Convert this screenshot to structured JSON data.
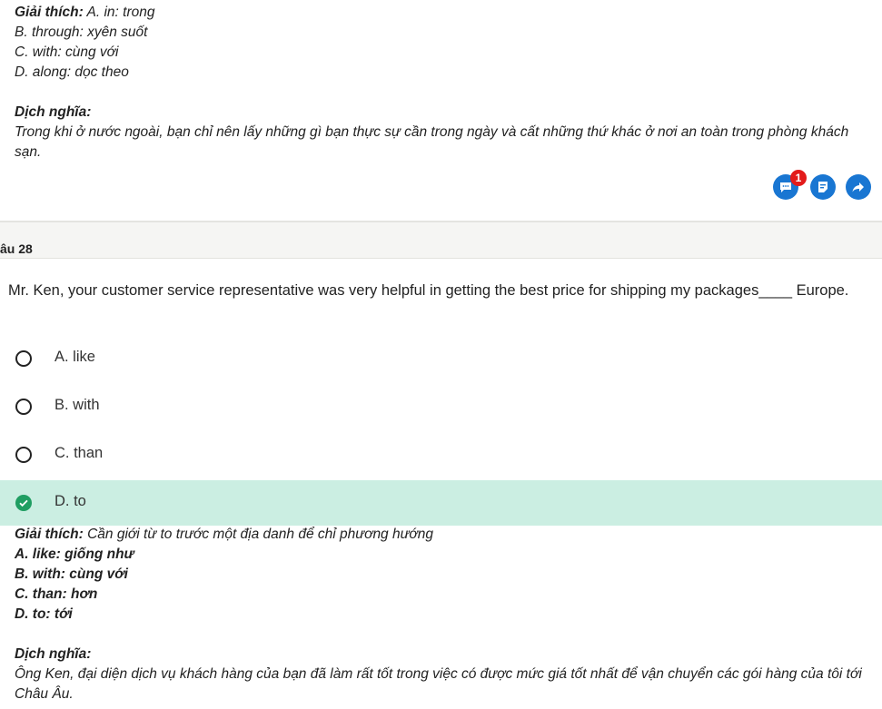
{
  "prev_explanation": {
    "label": "Giải thích:",
    "first": " A. in: trong",
    "options": [
      "B. through: xyên suốt",
      "C. with: cùng với",
      "D. along: dọc theo"
    ],
    "translation_label": "Dịch nghĩa:",
    "translation": "Trong khi ở nước ngoài, bạn chỉ nên lấy những gì bạn thực sự cần trong ngày và cất những thứ khác ở nơi an toàn trong phòng khách sạn."
  },
  "actions": {
    "comment_badge": "1",
    "colors": {
      "button": "#1976d2",
      "badge": "#e31b1b"
    }
  },
  "question": {
    "header": "âu 28",
    "text": "Mr. Ken, your customer service representative was very helpful in getting the best price for shipping my packages____ Europe.",
    "options": [
      {
        "label": "A. like"
      },
      {
        "label": "B. with"
      },
      {
        "label": "C. than"
      },
      {
        "label": "D. to"
      }
    ],
    "correct_color": "#cbeee2"
  },
  "explanation": {
    "label": "Giải thích:",
    "first": " Cần giới từ to trước một địa danh để chỉ phương hướng",
    "options": [
      "A. like: giống như",
      "B. with: cùng với",
      "C. than: hơn",
      "D. to: tới"
    ],
    "translation_label": "Dịch nghĩa:",
    "translation": "Ông Ken, đại diện dịch vụ khách hàng của bạn đã làm rất tốt trong việc có được mức giá tốt nhất để vận chuyển các gói hàng của tôi tới Châu Âu."
  }
}
